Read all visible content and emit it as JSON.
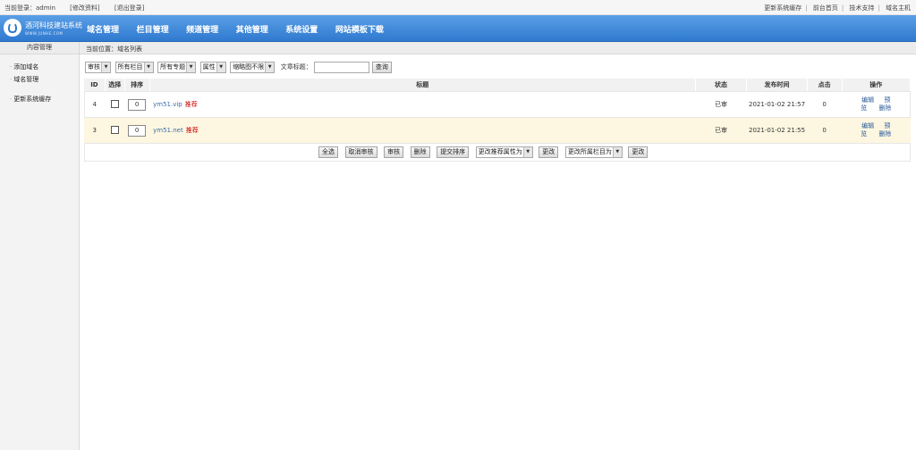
{
  "topbar": {
    "current_login": "当前登录：admin",
    "edit_profile": "[修改资料]",
    "logout": "[退出登录]",
    "links": [
      "更新系统缓存",
      "前台首页",
      "技术支持",
      "域名主机"
    ]
  },
  "logo": {
    "title": "酒河科技建站系统",
    "subtitle": "WWW.JUNHE.COM"
  },
  "nav": {
    "items": [
      "域名管理",
      "栏目管理",
      "频道管理",
      "其他管理",
      "系统设置",
      "网站模板下载"
    ]
  },
  "sidebar": {
    "header": "内容管理",
    "items": [
      "添加域名",
      "域名管理",
      "更新系统缓存"
    ]
  },
  "breadcrumb": "当前位置：域名列表",
  "filters": {
    "selects": [
      "审核",
      "所有栏目",
      "所有专题",
      "属性",
      "缩略图不限"
    ],
    "title_label": "文章标题：",
    "title_value": "",
    "search_button": "查询"
  },
  "table": {
    "headers": [
      "ID",
      "选择",
      "排序",
      "标题",
      "状态",
      "发布时间",
      "点击",
      "操作"
    ],
    "rows": [
      {
        "id": "4",
        "sort": "0",
        "title": "ym51.vip",
        "tag": "推荐",
        "status": "已审",
        "time": "2021-01-02 21:57",
        "clicks": "0",
        "op1": "编辑",
        "op2": "预",
        "op3": "览",
        "op4": "删除"
      },
      {
        "id": "3",
        "sort": "0",
        "title": "ym51.net",
        "tag": "推荐",
        "status": "已审",
        "time": "2021-01-02 21:55",
        "clicks": "0",
        "op1": "编辑",
        "op2": "预",
        "op3": "览",
        "op4": "删除"
      }
    ]
  },
  "actions": {
    "select_all": "全选",
    "cancel_review": "取消审核",
    "review": "审核",
    "delete": "删除",
    "submit_sort": "提交排序",
    "attr_select": "更改推荐属性为",
    "change1": "更改",
    "column_select": "更改所属栏目为",
    "change2": "更改"
  },
  "colors": {
    "nav": "#3a86d8",
    "row_highlight": "#fdf7e1",
    "tag": "#cc0000",
    "link": "#3b6ea5"
  }
}
